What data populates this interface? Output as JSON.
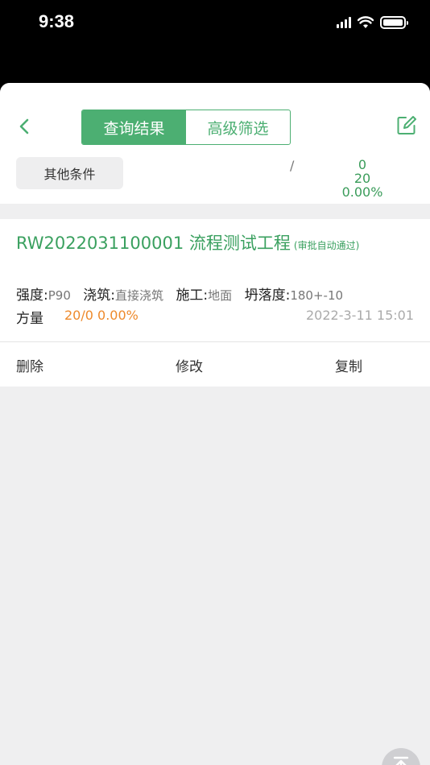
{
  "status": {
    "time": "9:38"
  },
  "nav": {
    "tabs": [
      {
        "label": "查询结果",
        "active": true
      },
      {
        "label": "高级筛选",
        "active": false
      }
    ]
  },
  "filter": {
    "other_label": "其他条件",
    "slash": "/",
    "stats": [
      "0",
      "20",
      "0.00%"
    ]
  },
  "card": {
    "code": "RW2022031100001",
    "name": "流程测试工程",
    "badge": "(审批自动通过)",
    "fields": [
      {
        "key": "强度:",
        "value": "P90"
      },
      {
        "key": "浇筑:",
        "value": "直接浇筑"
      },
      {
        "key": "施工:",
        "value": "地面"
      },
      {
        "key": "坍落度:",
        "value": "180+-10"
      }
    ],
    "qty_label": "方量",
    "qty_value": "20/0 0.00%",
    "time": "2022-3-11 15:01"
  },
  "actions": {
    "delete": "删除",
    "modify": "修改",
    "copy": "复制"
  },
  "colors": {
    "accent": "#4caf72",
    "orange": "#ee8a2c"
  }
}
